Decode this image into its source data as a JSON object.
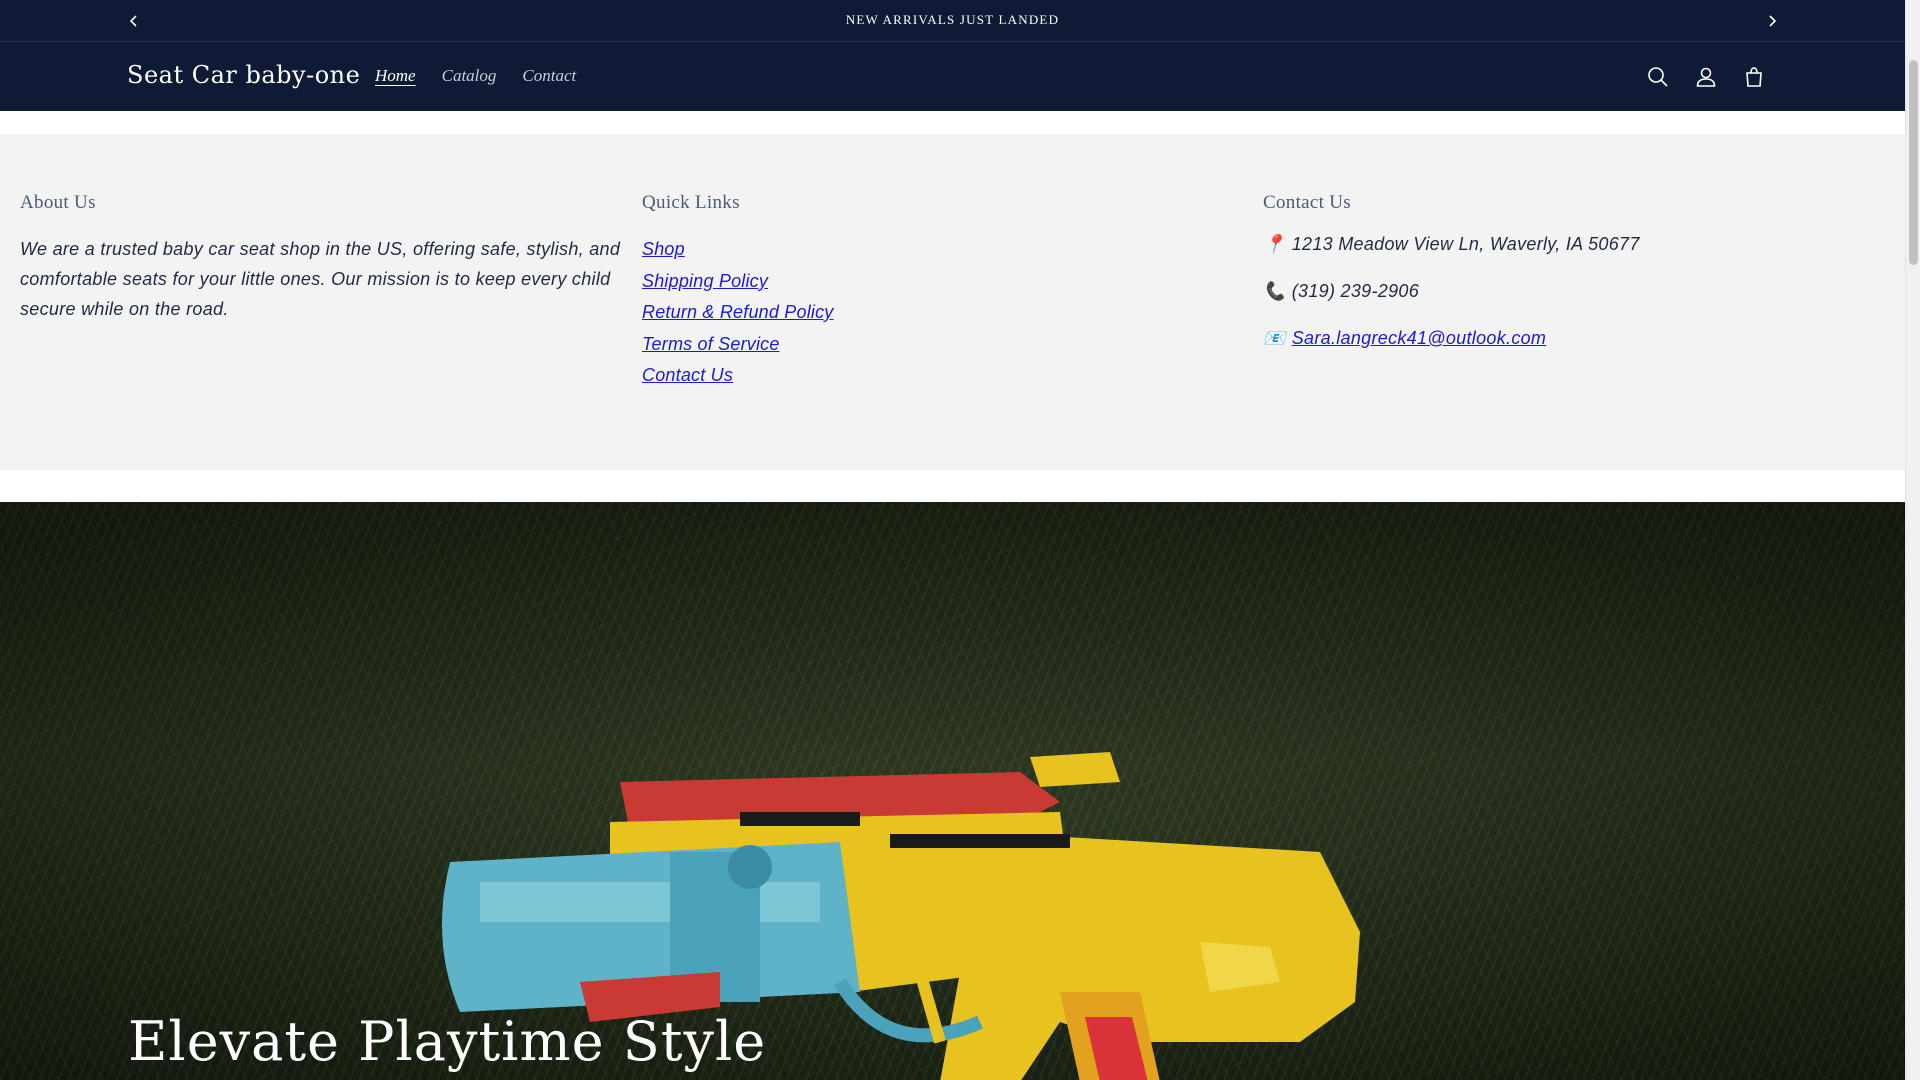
{
  "announcement": {
    "text": "NEW ARRIVALS JUST LANDED",
    "prev_icon": "chevron-left-icon",
    "next_icon": "chevron-right-icon"
  },
  "header": {
    "logo": "Seat Car baby-one",
    "nav": [
      {
        "label": "Home",
        "active": true
      },
      {
        "label": "Catalog",
        "active": false
      },
      {
        "label": "Contact",
        "active": false
      }
    ],
    "icons": [
      "search-icon",
      "account-icon",
      "cart-icon"
    ]
  },
  "about": {
    "heading": "About Us",
    "text": "We are a trusted baby car seat shop in the US, offering safe, stylish, and comfortable seats for your little ones. Our mission is to keep every child secure while on the road."
  },
  "quick_links": {
    "heading": "Quick Links",
    "items": [
      "Shop",
      "Shipping Policy",
      "Return & Refund Policy",
      "Terms of Service",
      "Contact Us"
    ]
  },
  "contact": {
    "heading": "Contact Us",
    "address_icon": "📍",
    "address": "1213 Meadow View Ln, Waverly, IA 50677",
    "phone_icon": "📞",
    "phone": "(319) 239-2906",
    "email_icon": "📧",
    "email": "Sara.langreck41@outlook.com"
  },
  "hero": {
    "headline": "Elevate Playtime Style"
  },
  "colors": {
    "header_bg": "#0f1a36",
    "link": "#1a1ad8",
    "info_bg": "#f3f3f3"
  }
}
